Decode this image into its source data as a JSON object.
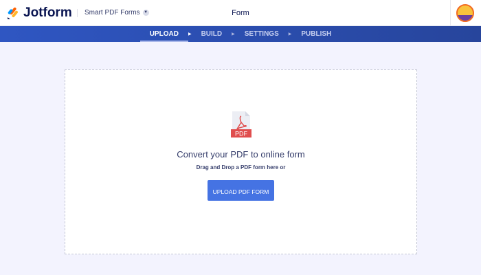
{
  "header": {
    "brand": "Jotform",
    "product": "Smart PDF Forms",
    "title": "Form"
  },
  "nav": {
    "tabs": [
      {
        "label": "UPLOAD"
      },
      {
        "label": "BUILD"
      },
      {
        "label": "SETTINGS"
      },
      {
        "label": "PUBLISH"
      }
    ]
  },
  "upload": {
    "pdf_label": "PDF",
    "heading": "Convert your PDF to online form",
    "subtext": "Drag and Drop a PDF form here or",
    "button": "UPLOAD PDF FORM"
  },
  "colors": {
    "accent": "#4573e3",
    "nav": "#2f56c2",
    "pdf_red": "#e04e4e"
  }
}
